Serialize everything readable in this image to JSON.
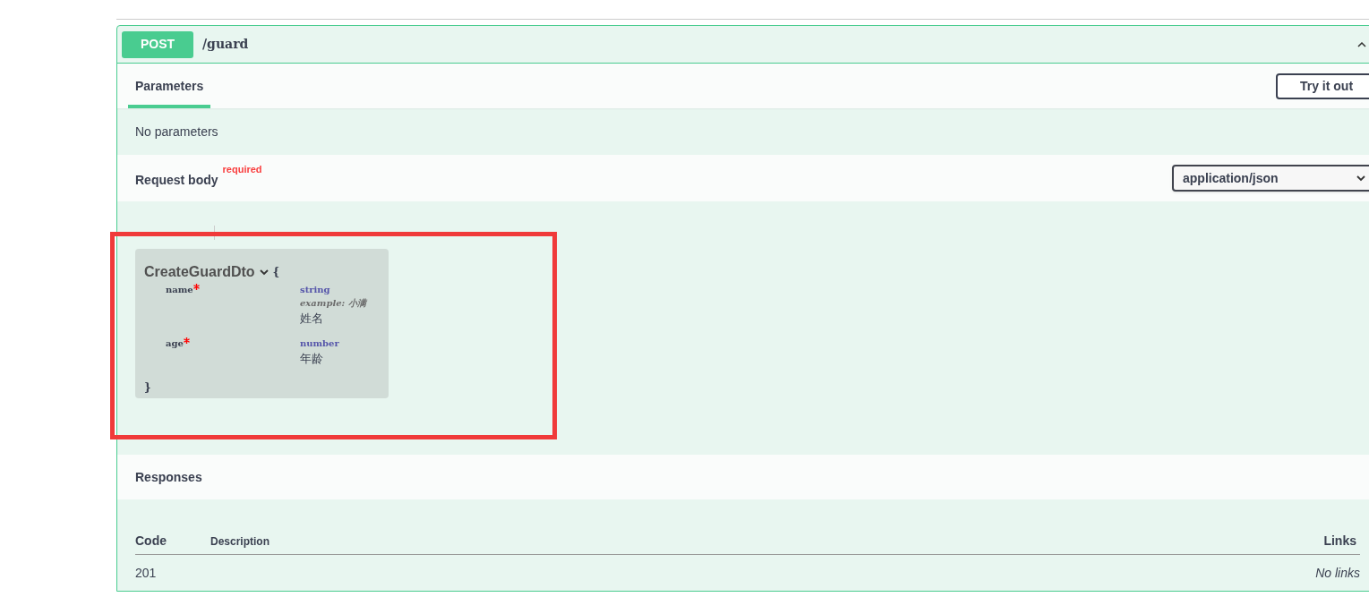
{
  "operation": {
    "method": "POST",
    "path": "/guard",
    "expanded": true
  },
  "parameters": {
    "tab": "Parameters",
    "button": "Try it out",
    "empty_text": "No parameters"
  },
  "request_body": {
    "title": "Request body",
    "required_label": "required",
    "content_type": "application/json",
    "model": {
      "name": "CreateGuardDto",
      "expanded": true,
      "open_brace": "{",
      "close_brace": "}",
      "properties": [
        {
          "name": "name",
          "required": true,
          "type": "string",
          "example": "example: 小满",
          "description": "姓名"
        },
        {
          "name": "age",
          "required": true,
          "type": "number",
          "description": "年龄"
        }
      ]
    }
  },
  "responses": {
    "title": "Responses",
    "columns": [
      "Code",
      "Description",
      "Links"
    ],
    "rows": [
      {
        "code": "201",
        "links": "No links"
      }
    ]
  }
}
